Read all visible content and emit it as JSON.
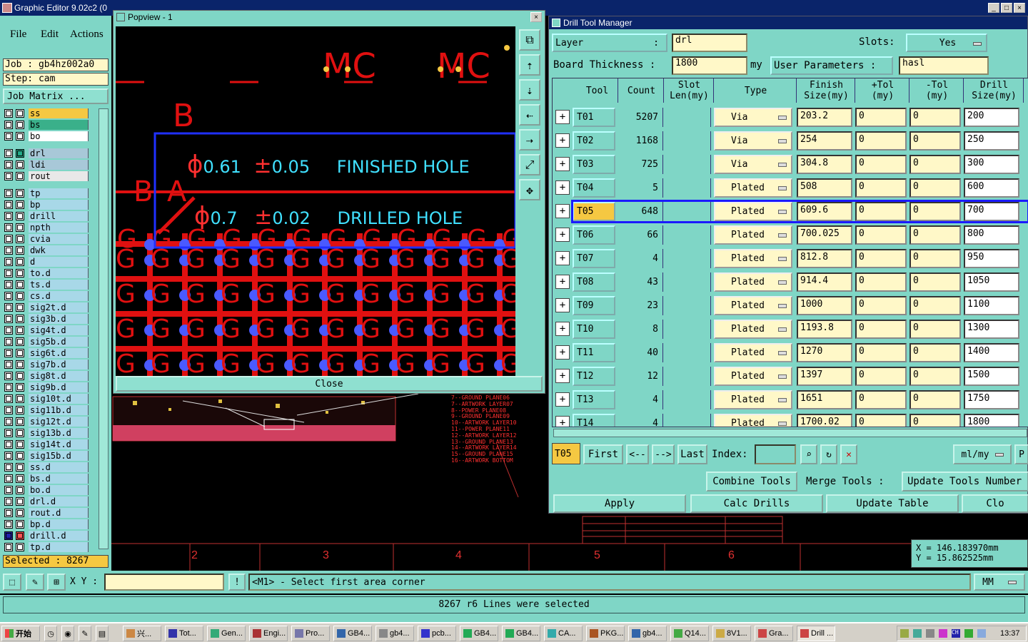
{
  "app": {
    "title": "Graphic Editor 9.02c2 (0",
    "menu": [
      "File",
      "Edit",
      "Actions"
    ],
    "job_label": "Job : gb4hz002a0",
    "step_label": "Step: cam",
    "job_matrix": "Job Matrix ...",
    "selected": "Selected : 8267",
    "layers_top": [
      {
        "name": "ss",
        "color": "#f5c842"
      },
      {
        "name": "bs",
        "color": "#3ab08a"
      },
      {
        "name": "bo",
        "color": "#ffffff"
      }
    ],
    "layers_mid": [
      {
        "name": "drl",
        "color": "#a8c8d8"
      },
      {
        "name": "ldi",
        "color": "#a8c8d8"
      },
      {
        "name": "rout",
        "color": "#e8e8e8"
      }
    ],
    "layers": [
      "tp",
      "bp",
      "drill",
      "npth",
      "cvia",
      "dwk",
      "d",
      "to.d",
      "ts.d",
      "cs.d",
      "sig2t.d",
      "sig3b.d",
      "sig4t.d",
      "sig5b.d",
      "sig6t.d",
      "sig7b.d",
      "sig8t.d",
      "sig9b.d",
      "sig10t.d",
      "sig11b.d",
      "sig12t.d",
      "sig13b.d",
      "sig14t.d",
      "sig15b.d",
      "ss.d",
      "bs.d",
      "bo.d",
      "drl.d",
      "rout.d",
      "bp.d",
      "drill.d",
      "tp.d"
    ]
  },
  "popview": {
    "title": "Popview - 1",
    "close_label": "Close",
    "line1": {
      "diam": "0.61",
      "tol": "0.05",
      "label": "FINISHED HOLE"
    },
    "line2": {
      "diam": "0.7",
      "tol": "0.02",
      "label": "DRILLED HOLE"
    },
    "text_mc": "MC",
    "text_b": "B",
    "text_a": "A"
  },
  "dtm": {
    "title": "Drill Tool Manager",
    "layer_label": "Layer",
    "layer_value": "drl",
    "slots_label": "Slots:",
    "slots_value": "Yes",
    "thickness_label": "Board Thickness :",
    "thickness_value": "1800",
    "thickness_unit": "my",
    "user_params_label": "User Parameters :",
    "user_params_value": "hasl",
    "headers": {
      "tool": "Tool",
      "count": "Count",
      "slot": "Slot\nLen(my)",
      "type": "Type",
      "finish": "Finish\nSize(my)",
      "ptol": "+Tol\n(my)",
      "mtol": "-Tol\n(my)",
      "drill": "Drill\nSize(my)"
    },
    "rows": [
      {
        "tool": "T01",
        "count": "5207",
        "type": "Via",
        "finish": "203.2",
        "ptol": "0",
        "mtol": "0",
        "drill": "200"
      },
      {
        "tool": "T02",
        "count": "1168",
        "type": "Via",
        "finish": "254",
        "ptol": "0",
        "mtol": "0",
        "drill": "250"
      },
      {
        "tool": "T03",
        "count": "725",
        "type": "Via",
        "finish": "304.8",
        "ptol": "0",
        "mtol": "0",
        "drill": "300"
      },
      {
        "tool": "T04",
        "count": "5",
        "type": "Plated",
        "finish": "508",
        "ptol": "0",
        "mtol": "0",
        "drill": "600"
      },
      {
        "tool": "T05",
        "count": "648",
        "type": "Plated",
        "finish": "609.6",
        "ptol": "0",
        "mtol": "0",
        "drill": "700"
      },
      {
        "tool": "T06",
        "count": "66",
        "type": "Plated",
        "finish": "700.025",
        "ptol": "0",
        "mtol": "0",
        "drill": "800"
      },
      {
        "tool": "T07",
        "count": "4",
        "type": "Plated",
        "finish": "812.8",
        "ptol": "0",
        "mtol": "0",
        "drill": "950"
      },
      {
        "tool": "T08",
        "count": "43",
        "type": "Plated",
        "finish": "914.4",
        "ptol": "0",
        "mtol": "0",
        "drill": "1050"
      },
      {
        "tool": "T09",
        "count": "23",
        "type": "Plated",
        "finish": "1000",
        "ptol": "0",
        "mtol": "0",
        "drill": "1100"
      },
      {
        "tool": "T10",
        "count": "8",
        "type": "Plated",
        "finish": "1193.8",
        "ptol": "0",
        "mtol": "0",
        "drill": "1300"
      },
      {
        "tool": "T11",
        "count": "40",
        "type": "Plated",
        "finish": "1270",
        "ptol": "0",
        "mtol": "0",
        "drill": "1400"
      },
      {
        "tool": "T12",
        "count": "12",
        "type": "Plated",
        "finish": "1397",
        "ptol": "0",
        "mtol": "0",
        "drill": "1500"
      },
      {
        "tool": "T13",
        "count": "4",
        "type": "Plated",
        "finish": "1651",
        "ptol": "0",
        "mtol": "0",
        "drill": "1750"
      },
      {
        "tool": "T14",
        "count": "4",
        "type": "Plated",
        "finish": "1700.02",
        "ptol": "0",
        "mtol": "0",
        "drill": "1800"
      }
    ],
    "selected_tool": "T05",
    "nav": {
      "first": "First",
      "prev": "<--",
      "next": "-->",
      "last": "Last",
      "index_label": "Index:",
      "units": "ml/my"
    },
    "combine_label": "Combine Tools",
    "merge_label": "Merge Tools :",
    "update_numbers_label": "Update Tools Number",
    "apply_label": "Apply",
    "calc_label": "Calc Drills",
    "update_table_label": "Update Table",
    "close_label": "Clo"
  },
  "coords": {
    "x": "X = 146.183970mm",
    "y": "Y = 15.862525mm"
  },
  "ruler": [
    "2",
    "3",
    "4",
    "5",
    "6"
  ],
  "cad_notes": [
    "7--GROUND PLANE06",
    "7--ARTWORK LAYER07",
    "8--POWER PLANE08",
    "9--GROUND PLANE09",
    "10--ARTWORK LAYER10",
    "11--POWER PLANE11",
    "12--ARTWORK LAYER12",
    "13--GROUND PLANE13",
    "14--ARTWORK LAYER14",
    "15--GROUND PLANE15",
    "16--ARTWORK BOTTOM"
  ],
  "command": {
    "xy_label": "X Y :",
    "prompt": "<M1> - Select first area corner",
    "units": "MM"
  },
  "status": "8267 r6 Lines were selected",
  "taskbar": {
    "start": "开始",
    "items": [
      "兴...",
      "Tot...",
      "Gen...",
      "Engi...",
      "Pro...",
      "GB4...",
      "gb4...",
      "pcb...",
      "GB4...",
      "GB4...",
      "CA...",
      "PKG...",
      "gb4...",
      "Q14...",
      "8V1...",
      "Gra...",
      "Drill ..."
    ],
    "time": "13:37"
  }
}
